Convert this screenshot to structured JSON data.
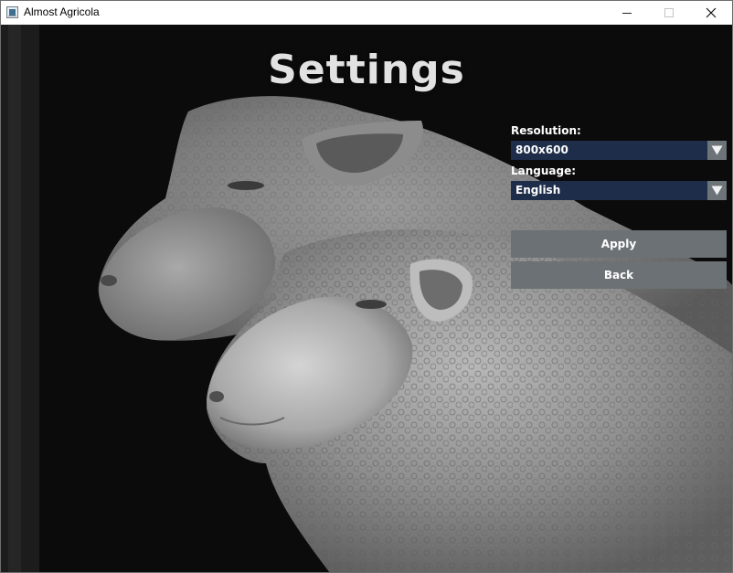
{
  "window": {
    "title": "Almost Agricola",
    "icons": {
      "app": "app-window-icon",
      "minimize": "minimize-icon",
      "maximize": "maximize-icon",
      "close": "close-icon"
    }
  },
  "page": {
    "title": "Settings"
  },
  "settings": {
    "resolution": {
      "label": "Resolution:",
      "value": "800x600"
    },
    "language": {
      "label": "Language:",
      "value": "English"
    }
  },
  "buttons": {
    "apply": "Apply",
    "back": "Back"
  },
  "colors": {
    "dropdown_bg": "#1e2d4a",
    "dropdown_arrow_bg": "#6d7479",
    "button_bg": "#6b7175",
    "title_text": "#e2e2e2"
  }
}
